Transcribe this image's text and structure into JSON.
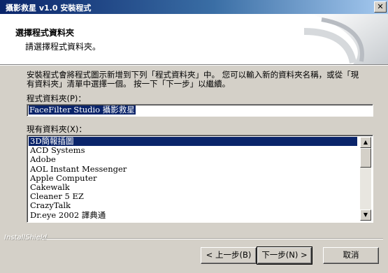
{
  "window": {
    "title": "攝影救星 v1.0 安裝程式",
    "close_label": "✕"
  },
  "header": {
    "title": "選擇程式資料夾",
    "subtitle": "請選擇程式資料夾。"
  },
  "body": {
    "description": "安裝程式會將程式圖示新增到下列「程式資料夾」中。 您可以輸入新的資料夾名稱，或從「現有資料夾」清單中選擇一個。 按一下「下一步」以繼續。",
    "program_folder_label": "程式資料夾(P)：",
    "program_folder_value": "FaceFilter Studio 攝影救星",
    "existing_folders_label": "現有資料夾(X)：",
    "existing_folders": [
      "3D簡報插圖",
      "ACD Systems",
      "Adobe",
      "AOL Instant Messenger",
      "Apple Computer",
      "Cakewalk",
      "Cleaner 5 EZ",
      "CrazyTalk",
      "Dr.eye 2002 譯典通"
    ],
    "selected_index": 0
  },
  "footer": {
    "brand": "InstallShield",
    "back_label": "< 上一步(B)",
    "next_label": "下一步(N) >",
    "cancel_label": "取消"
  },
  "scrollbar": {
    "up_icon": "▲",
    "down_icon": "▼"
  }
}
